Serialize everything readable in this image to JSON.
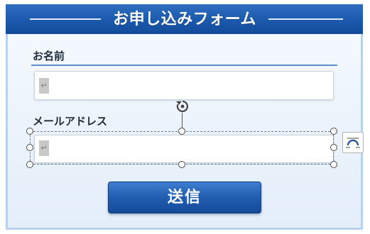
{
  "form": {
    "title": "お申し込みフォーム",
    "name_label": "お名前",
    "email_label": "メールアドレス",
    "name_value": "",
    "email_value": "",
    "paragraph_mark": "↵",
    "submit_label": "送信"
  },
  "icons": {
    "rotate": "rotate-handle-icon",
    "layout_options": "layout-options-icon"
  },
  "colors": {
    "header_blue": "#1b59ad",
    "panel_border": "#b9d2ec",
    "button_blue": "#235fb3",
    "underline": "#5a8fc7"
  }
}
